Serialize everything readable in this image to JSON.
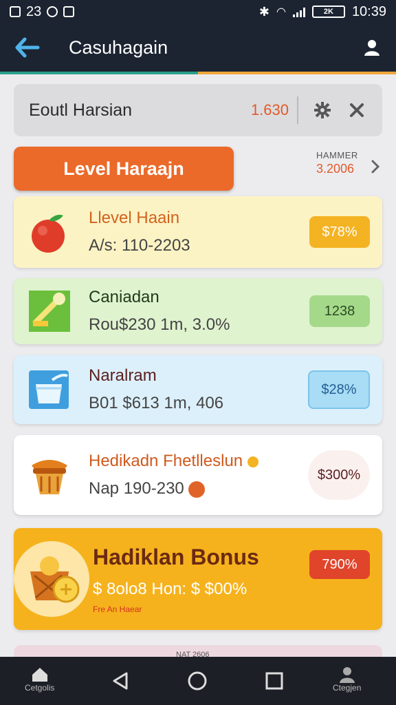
{
  "status": {
    "left_time": "23",
    "battery": "2K",
    "clock": "10:39"
  },
  "appbar": {
    "title": "Casuhagain",
    "back_icon": "back-arrow-icon",
    "profile_icon": "user-icon"
  },
  "search": {
    "text": "Eoutl Harsian",
    "value": "1.630",
    "gear_icon": "gear-icon",
    "close_icon": "close-icon"
  },
  "level_button": {
    "label": "Level Haraajn"
  },
  "banner": {
    "label": "HAMMER",
    "value": "3.2006"
  },
  "cards": [
    {
      "title": "Llevel Haain",
      "subtitle": "A/s: 110-2203",
      "badge": "$78%",
      "icon": "apple-icon"
    },
    {
      "title": "Caniadan",
      "subtitle": "Rou$230 1m, 3.0%",
      "badge": "1238",
      "icon": "paint-icon"
    },
    {
      "title": "Naralram",
      "subtitle": "B01 $613 1m, 406",
      "badge": "$28%",
      "icon": "cup-icon"
    },
    {
      "title": "Hedikadn Fhetlleslun",
      "subtitle": "Nap 190-230",
      "badge": "$300%",
      "icon": "basket-icon"
    },
    {
      "title": "Hadiklan Bonus",
      "subtitle": "$ 8olo8 Hon: $ $00%",
      "small": "Fre An Haear",
      "badge": "790%",
      "icon": "bonus-basket-icon"
    }
  ],
  "peek": {
    "label": "NAT 2606"
  },
  "nav": {
    "left_label": "Cetgolis",
    "right_label": "Ctegjen"
  },
  "colors": {
    "appbar": "#1c2432",
    "accent": "#eb6a2a",
    "bonus": "#f6b21d"
  }
}
